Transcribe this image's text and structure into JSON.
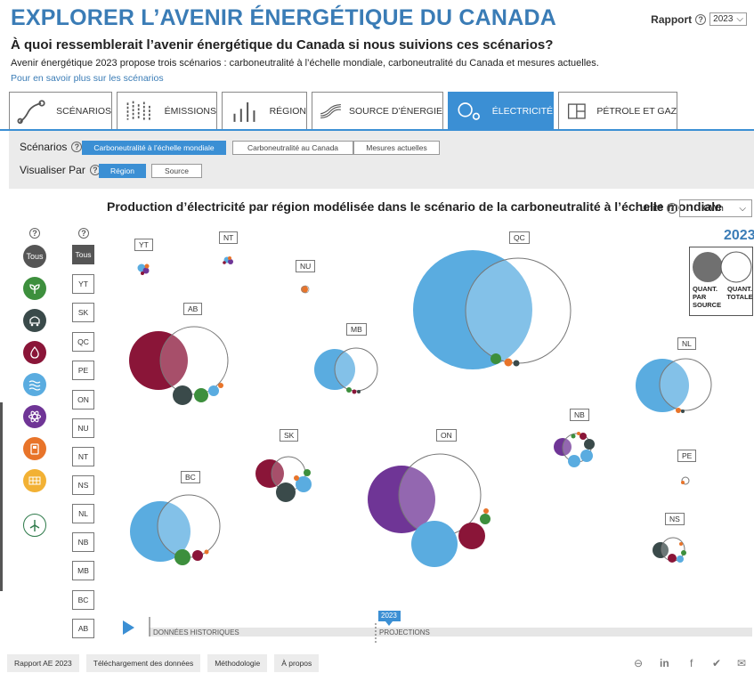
{
  "header": {
    "title": "EXPLORER L’AVENIR ÉNERGÉTIQUE DU CANADA",
    "report_label": "Rapport",
    "report_year": "2023",
    "question": "À quoi ressemblerait l’avenir énergétique du Canada si nous suivions ces scénarios?",
    "description": "Avenir énergétique 2023 propose trois scénarios : carboneutralité à l’échelle mondiale, carboneutralité du Canada et mesures actuelles.",
    "learn_more": "Pour en savoir plus sur les scénarios"
  },
  "tabs": [
    {
      "label": "SCÉNARIOS",
      "icon": "scenarios-icon"
    },
    {
      "label": "ÉMISSIONS",
      "icon": "emissions-icon"
    },
    {
      "label": "RÉGION",
      "icon": "region-icon"
    },
    {
      "label": "SOURCE D’ÉNERGIE",
      "icon": "energy-source-icon"
    },
    {
      "label": "ÉLECTRICITÉ",
      "icon": "electricity-icon",
      "active": true
    },
    {
      "label": "PÉTROLE ET GAZ",
      "icon": "oil-gas-icon"
    }
  ],
  "controls": {
    "scenarios_label": "Scénarios",
    "scenarios": [
      "Carboneutralité à l’échelle mondiale",
      "Carboneutralité au Canada",
      "Mesures actuelles"
    ],
    "scenario_selected": "Carboneutralité à l’échelle mondiale",
    "view_by_label": "Visualiser Par",
    "view_by": [
      "Région",
      "Source"
    ],
    "view_by_selected": "Région"
  },
  "chart": {
    "title": "Production d’électricité par région modélisée dans le scénario de la carboneutralité à l’échelle mondiale",
    "unit_label": "Unité",
    "unit_value": "GWh",
    "year": "2023",
    "legend_by_source": "QUANT. PAR SOURCE",
    "legend_total": "QUANT. TOTALE"
  },
  "source_filters": {
    "all_label": "Tous",
    "items": [
      {
        "name": "biomass-icon",
        "color": "#3d8f3d"
      },
      {
        "name": "coal-icon",
        "color": "#3a4a4a"
      },
      {
        "name": "gas-icon",
        "color": "#8a1538"
      },
      {
        "name": "hydro-icon",
        "color": "#5aace0"
      },
      {
        "name": "nuclear-icon",
        "color": "#6f3596"
      },
      {
        "name": "oil-icon",
        "color": "#e8742a"
      },
      {
        "name": "solar-icon",
        "color": "#f2b134"
      },
      {
        "name": "wind-icon",
        "color": "#2e7a4a"
      }
    ]
  },
  "region_filters": [
    "Tous",
    "YT",
    "SK",
    "QC",
    "PE",
    "ON",
    "NU",
    "NT",
    "NS",
    "NL",
    "NB",
    "MB",
    "BC",
    "AB"
  ],
  "regions": [
    {
      "code": "YT"
    },
    {
      "code": "NT"
    },
    {
      "code": "NU"
    },
    {
      "code": "QC"
    },
    {
      "code": "AB"
    },
    {
      "code": "MB"
    },
    {
      "code": "NL"
    },
    {
      "code": "NB"
    },
    {
      "code": "SK"
    },
    {
      "code": "ON"
    },
    {
      "code": "PE"
    },
    {
      "code": "BC"
    },
    {
      "code": "NS"
    }
  ],
  "timeline": {
    "historical_label": "DONNÉES HISTORIQUES",
    "projections_label": "PROJECTIONS",
    "current_year": "2023"
  },
  "footer": {
    "buttons": [
      "Rapport AE 2023",
      "Téléchargement des données",
      "Méthodologie",
      "À propos"
    ],
    "share_icons": [
      "link-icon",
      "linkedin-icon",
      "facebook-icon",
      "twitter-icon",
      "email-icon"
    ]
  }
}
